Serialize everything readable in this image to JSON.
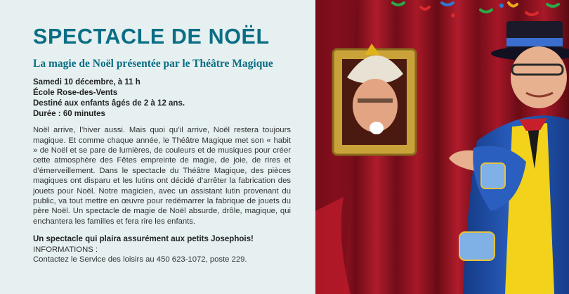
{
  "event": {
    "title": "SPECTACLE DE NOËL",
    "subtitle": "La magie de Noël présentée par le Théâtre Magique",
    "details": [
      "Samedi 10 décembre, à 11 h",
      "École Rose-des-Vents",
      "Destiné aux enfants âgés de 2 à 12 ans.",
      "Durée : 60 minutes"
    ],
    "description": "Noël arrive, l’hiver aussi. Mais quoi qu’il arrive, Noël restera toujours magique. Et comme chaque année, le Théâtre Magique met son « habit » de Noël et se pare de lumières, de couleurs et de musiques pour créer cette atmosphère des Fêtes empreinte de magie, de joie, de rires et d’émerveillement. Dans le spectacle du Théâtre Magique, des pièces magiques ont disparu et les lutins ont décidé d’arrêter la fabrication des jouets pour Noël. Notre magicien, avec un assistant lutin provenant du public, va tout mettre en œuvre pour redémarrer la fabrique de jouets du père Noël. Un spectacle de magie de Noël absurde, drôle, magique, qui enchantera les familles et fera rire les enfants.",
    "tagline": "Un spectacle qui plaira assurément aux petits Josephois!",
    "info_heading": "INFORMATIONS :",
    "info_contact": "Contactez le Service des loisirs au 450 623-1072, poste 229."
  },
  "photo": {
    "icon": "magician-and-elf-photo",
    "colors": {
      "curtain": "#9e1420",
      "curtain_dark": "#5a0a12",
      "frame_gold": "#c9a23a",
      "coat_blue": "#1f4fa8",
      "vest_yellow": "#f2d21b",
      "skin": "#e7b08f"
    }
  },
  "colors": {
    "background": "#e6f0f1",
    "title_teal": "#0b6e84",
    "text": "#333333"
  }
}
